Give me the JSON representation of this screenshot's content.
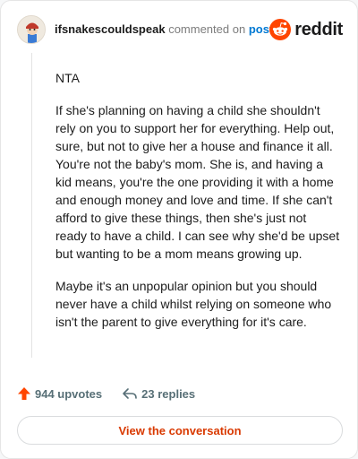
{
  "header": {
    "username": "ifsnakescouldspeak",
    "commented_text": "commented on",
    "post_link": "post",
    "brand": "reddit",
    "brand_color": "#ff4500"
  },
  "comment": {
    "paragraphs": [
      "NTA",
      "If she's planning on having a child she shouldn't rely on you to support her for everything. Help out, sure, but not to give her a house and finance it all. You're not the baby's mom. She is, and having a kid means, you're the one providing it with a home and enough money and love and time. If she can't afford to give these things, then she's just not ready to have a child. I can see why she'd be upset but wanting to be a mom means growing up.",
      "Maybe it's an unpopular opinion but you should never have a child whilst relying on someone who isn't the parent to give everything for it's care."
    ]
  },
  "actions": {
    "upvotes": "944 upvotes",
    "replies": "23 replies"
  },
  "footer": {
    "view_conversation": "View the conversation"
  },
  "icons": {
    "avatar": "user-avatar",
    "brand_logo": "reddit-snoo-icon",
    "upvote": "upvote-arrow-icon",
    "reply": "reply-arrow-icon"
  },
  "colors": {
    "accent": "#d93900",
    "link": "#0079d3",
    "upvote": "#ff4500"
  }
}
